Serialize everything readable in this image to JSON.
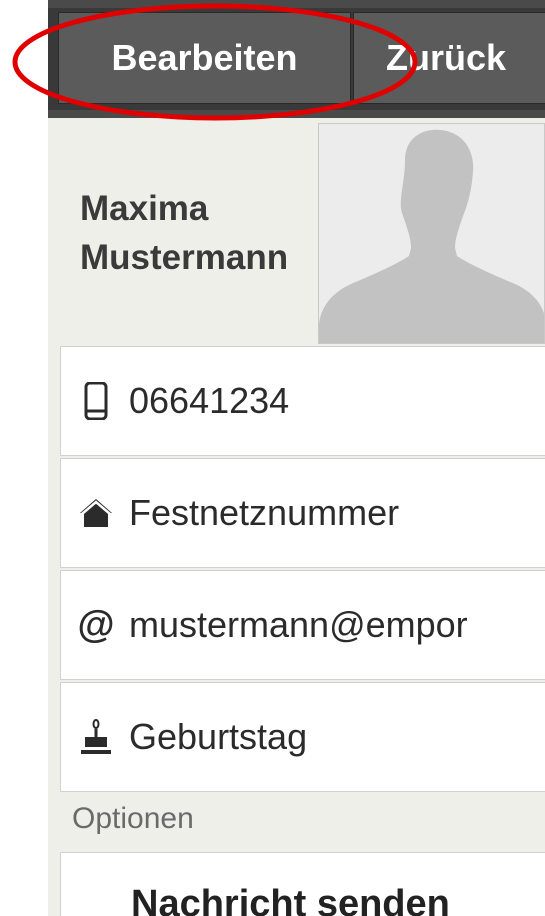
{
  "toolbar": {
    "edit_label": "Bearbeiten",
    "back_label": "Zurück"
  },
  "contact": {
    "first_name": "Maxima",
    "last_name": "Mustermann"
  },
  "fields": [
    {
      "icon": "mobile-phone-icon",
      "value": "06641234"
    },
    {
      "icon": "home-icon",
      "value": "Festnetznummer"
    },
    {
      "icon": "at-sign-icon",
      "value": "mustermann@empor"
    },
    {
      "icon": "birthday-cake-icon",
      "value": "Geburtstag"
    }
  ],
  "options": {
    "section_label": "Optionen",
    "send_message_label": "Nachricht senden"
  },
  "colors": {
    "highlight": "#e00000",
    "toolbar": "#393939",
    "button": "#5b5b5b",
    "background": "#efefea"
  }
}
